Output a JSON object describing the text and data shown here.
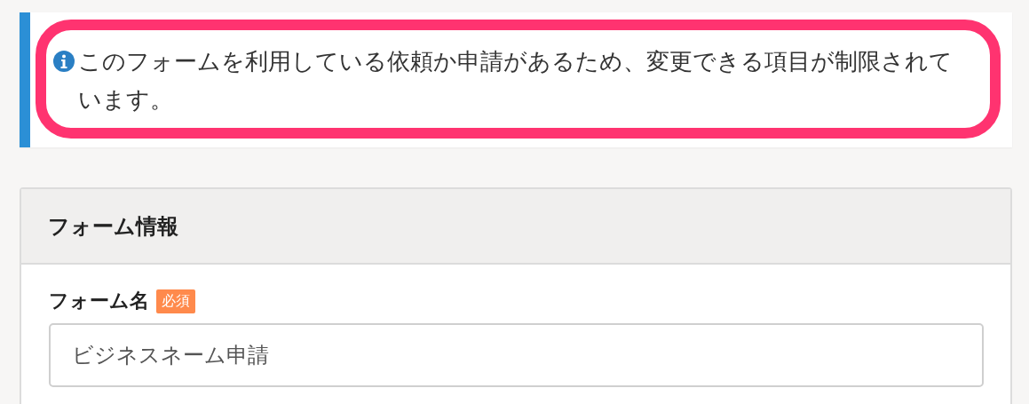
{
  "notice": {
    "text": "このフォームを利用している依頼か申請があるため、変更できる項目が制限されています。"
  },
  "panel": {
    "title": "フォーム情報",
    "fields": [
      {
        "label": "フォーム名",
        "required": true,
        "badge": "必須",
        "value": "ビジネスネーム申請"
      }
    ]
  }
}
